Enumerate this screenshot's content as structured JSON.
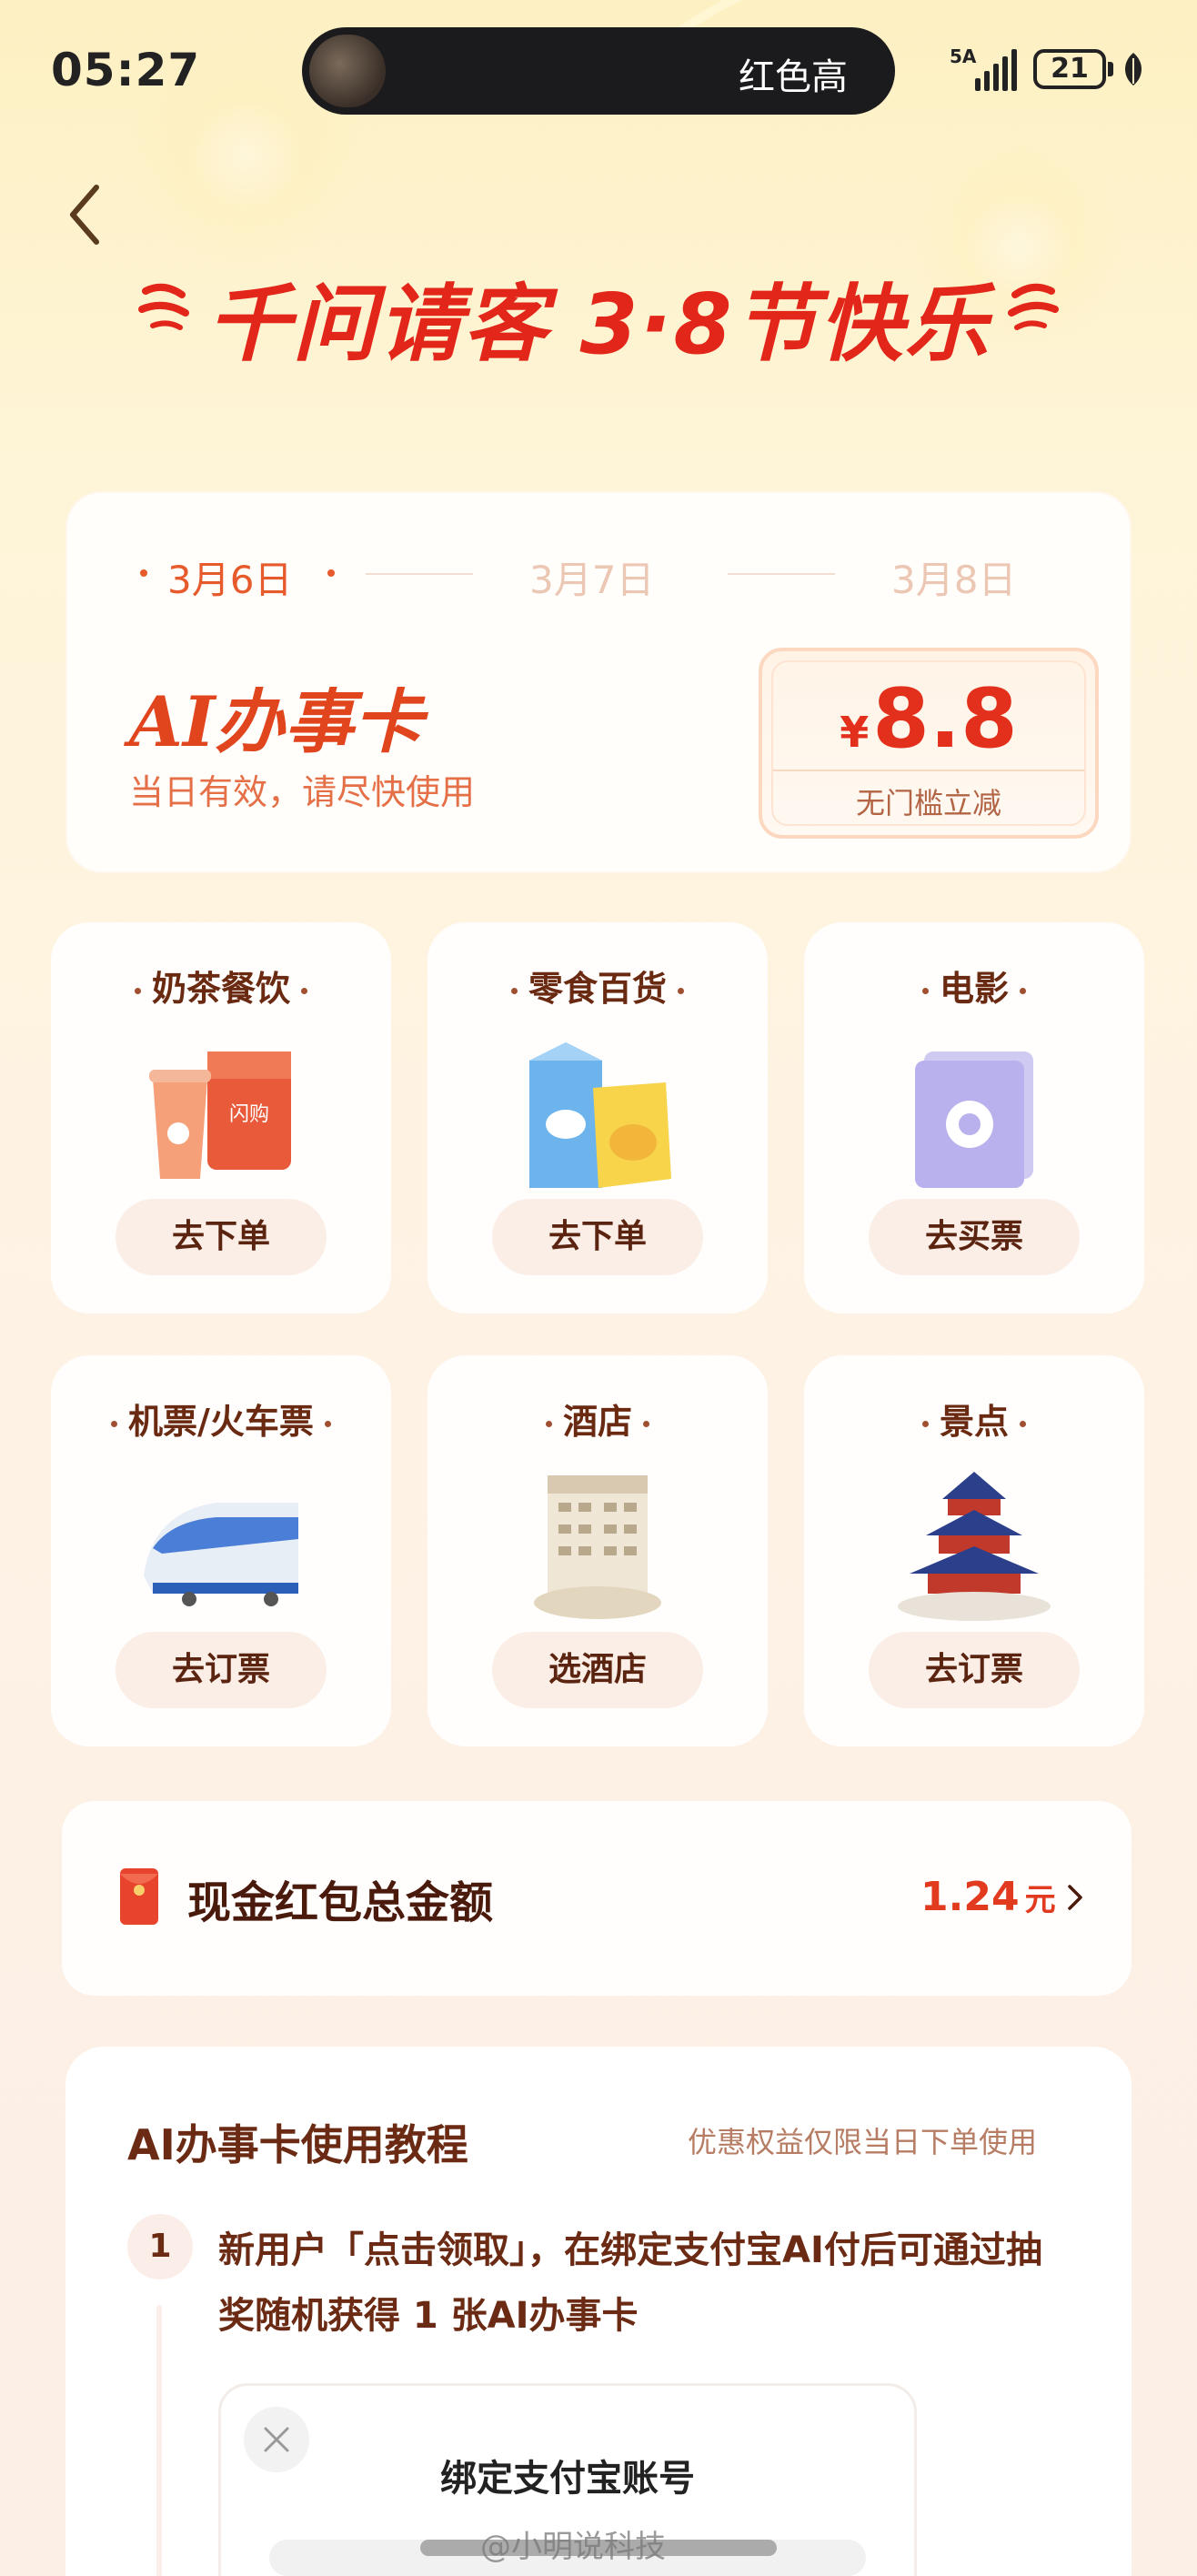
{
  "status_bar": {
    "time": "05:27",
    "island_text": "红色高",
    "network": "5A",
    "battery": "21"
  },
  "header": {
    "title": "千问请客 3·8节快乐"
  },
  "coupon": {
    "dates": [
      {
        "label": "3月6日",
        "active": true
      },
      {
        "label": "3月7日",
        "active": false
      },
      {
        "label": "3月8日",
        "active": false
      }
    ],
    "title": "AI办事卡",
    "subtitle": "当日有效，请尽快使用",
    "currency": "¥",
    "amount": "8.8",
    "amount_label": "无门槛立减"
  },
  "categories": [
    {
      "title": "奶茶餐饮",
      "button": "去下单",
      "icon": "milk-tea-bag-icon"
    },
    {
      "title": "零食百货",
      "button": "去下单",
      "icon": "snack-milk-icon"
    },
    {
      "title": "电影",
      "button": "去买票",
      "icon": "movie-ticket-icon"
    },
    {
      "title": "机票/火车票",
      "button": "去订票",
      "icon": "train-icon"
    },
    {
      "title": "酒店",
      "button": "选酒店",
      "icon": "hotel-icon"
    },
    {
      "title": "景点",
      "button": "去订票",
      "icon": "temple-icon"
    }
  ],
  "red_packet": {
    "label": "现金红包总金额",
    "amount": "1.24",
    "unit": "元"
  },
  "tutorial": {
    "title": "AI办事卡使用教程",
    "note": "优惠权益仅限当日下单使用",
    "steps": [
      {
        "number": "1",
        "text": "新用户「点击领取」，在绑定支付宝AI付后可通过抽奖随机获得 1 张AI办事卡"
      }
    ],
    "modal_title": "绑定支付宝账号"
  },
  "watermark": "@小明说科技",
  "colors": {
    "accent_red": "#e3261a",
    "coupon_orange": "#e65a2b",
    "brown_text": "#6b2a13"
  }
}
